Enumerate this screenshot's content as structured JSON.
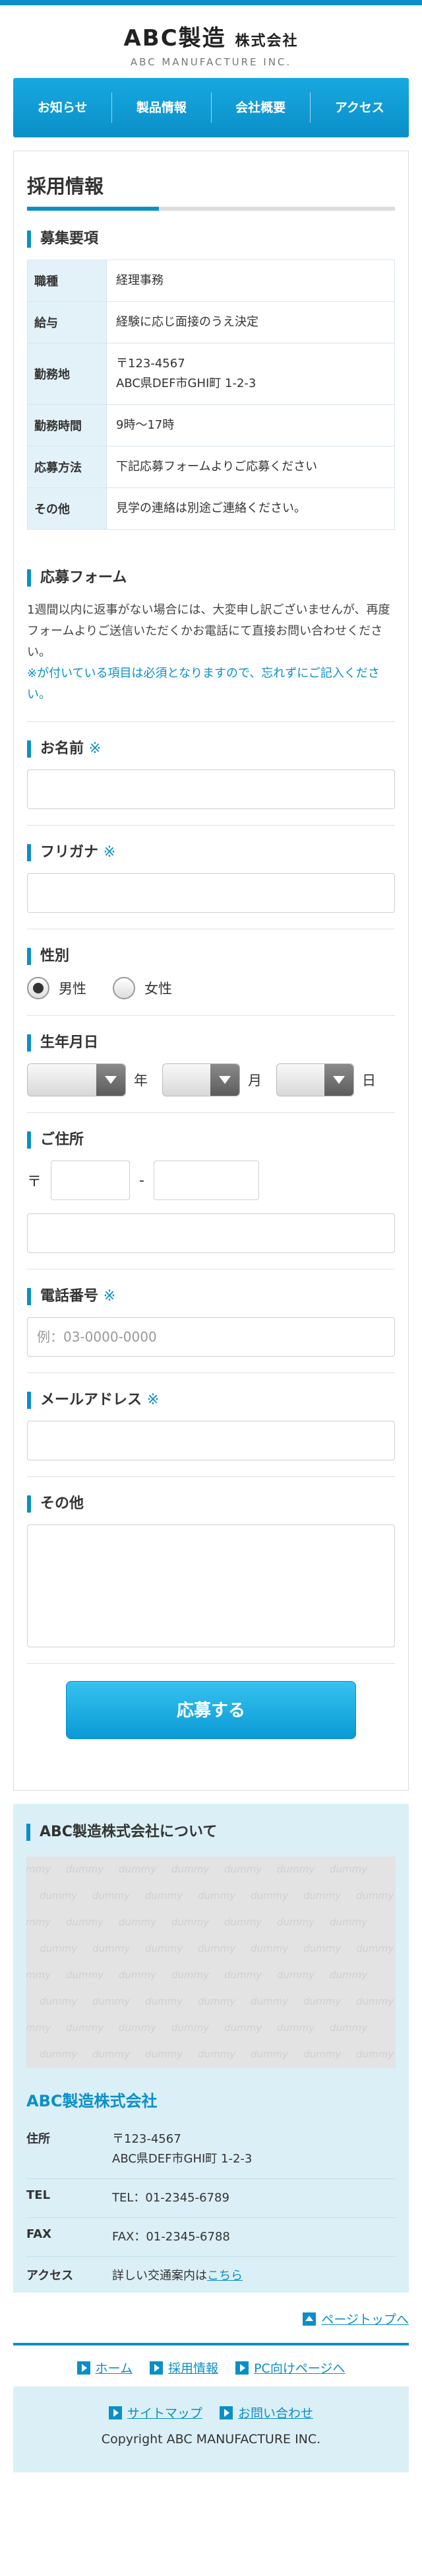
{
  "header": {
    "company_name": "ABC製造",
    "company_suffix": "株式会社",
    "company_en": "ABC MANUFACTURE INC."
  },
  "nav": [
    "お知らせ",
    "製品情報",
    "会社概要",
    "アクセス"
  ],
  "page_title": "採用情報",
  "requirements": {
    "heading": "募集要項",
    "rows": [
      {
        "label": "職種",
        "value": "経理事務"
      },
      {
        "label": "給与",
        "value": "経験に応じ面接のうえ決定"
      },
      {
        "label": "勤務地",
        "value": "〒123-4567",
        "value2": "ABC県DEF市GHI町 1-2-3"
      },
      {
        "label": "勤務時間",
        "value": "9時〜17時"
      },
      {
        "label": "応募方法",
        "value": "下記応募フォームよりご応募ください"
      },
      {
        "label": "その他",
        "value": "見学の連絡は別途ご連絡ください。"
      }
    ]
  },
  "form": {
    "heading": "応募フォーム",
    "intro": "1週間以内に返事がない場合には、大変申し訳ございませんが、再度フォームよりご送信いただくかお電話にて直接お問い合わせください。",
    "required_note": "※が付いている項目は必須となりますので、忘れずにご記入ください。",
    "required_mark": "※",
    "name_label": "お名前",
    "kana_label": "フリガナ",
    "gender_label": "性別",
    "gender_options": [
      "男性",
      "女性"
    ],
    "gender_selected": "男性",
    "birth_label": "生年月日",
    "birth_units": [
      "年",
      "月",
      "日"
    ],
    "address_label": "ご住所",
    "postal_mark": "〒",
    "postal_sep": "-",
    "phone_label": "電話番号",
    "phone_placeholder": "例：03-0000-0000",
    "email_label": "メールアドレス",
    "other_label": "その他",
    "submit_label": "応募する"
  },
  "company": {
    "heading": "ABC製造株式会社について",
    "dummy_text": "dummy",
    "name": "ABC製造株式会社",
    "rows": [
      {
        "label": "住所",
        "value": "〒123-4567",
        "value2": "ABC県DEF市GHI町 1-2-3"
      },
      {
        "label": "TEL",
        "value": "TEL：01-2345-6789"
      },
      {
        "label": "FAX",
        "value": "FAX：01-2345-6788"
      },
      {
        "label": "アクセス",
        "value": "詳しい交通案内は",
        "link": "こちら"
      }
    ]
  },
  "pagetop": "ページトップへ",
  "footer_nav": [
    "ホーム",
    "採用情報",
    "PC向けページへ"
  ],
  "footer_links": [
    "サイトマップ",
    "お問い合わせ"
  ],
  "copyright": "Copyright ABC MANUFACTURE INC.",
  "colors": {
    "accent": "#0a8fc8",
    "light_bg": "#dbeff6"
  }
}
